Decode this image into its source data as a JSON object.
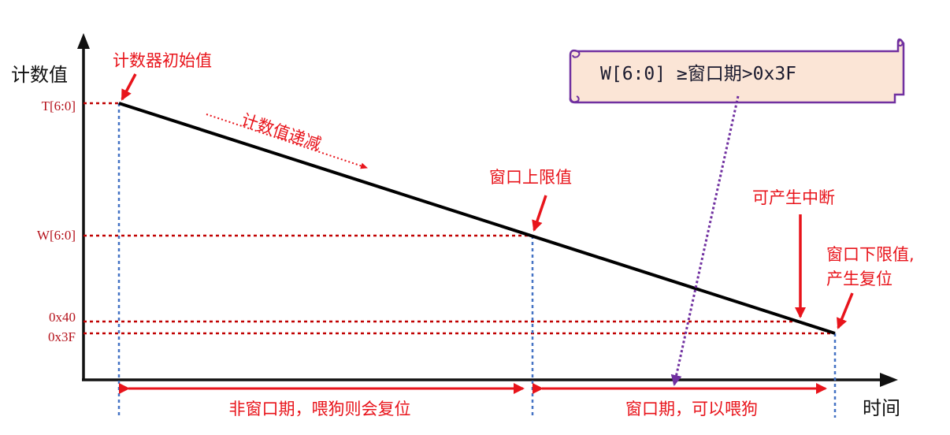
{
  "axes": {
    "y_label": "计数值",
    "x_label": "时间"
  },
  "y_ticks": [
    "T[6:0]",
    "W[6:0]",
    "0x40",
    "0x3F"
  ],
  "annotations": {
    "counter_initial": "计数器初始值",
    "counter_decreasing": "计数值递减",
    "window_upper": "窗口上限值",
    "can_interrupt": "可产生中断",
    "window_lower_line1": "窗口下限值,",
    "window_lower_line2": "产生复位"
  },
  "scroll_box": {
    "text": "W[6:0] ≥窗口期>0x3F"
  },
  "periods": {
    "non_window": "非窗口期，喂狗则会复位",
    "window": "窗口期，可以喂狗"
  },
  "colors": {
    "red": "#e8141b",
    "dark_red": "#b5121b",
    "blue_dotted": "#4472c4",
    "purple": "#7030a0",
    "scroll_fill": "#fbe5d6"
  }
}
